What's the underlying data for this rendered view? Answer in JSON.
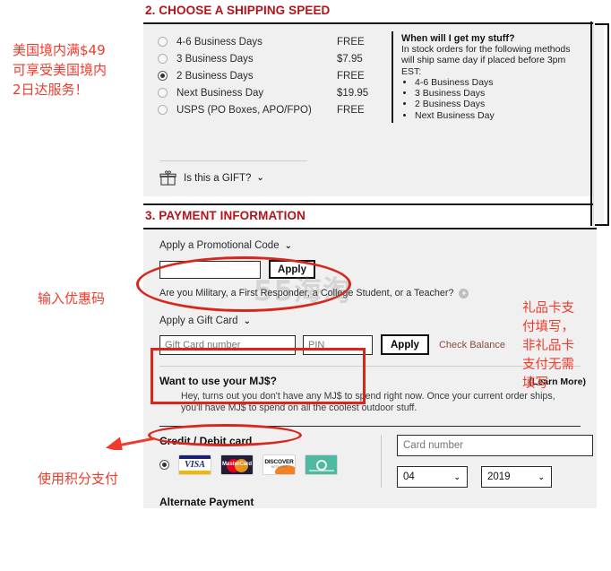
{
  "shipping": {
    "heading": "2. CHOOSE A SHIPPING SPEED",
    "options": [
      {
        "label": "4-6 Business Days",
        "price": "FREE",
        "selected": false
      },
      {
        "label": "3 Business Days",
        "price": "$7.95",
        "selected": false
      },
      {
        "label": "2 Business Days",
        "price": "FREE",
        "selected": true
      },
      {
        "label": "Next Business Day",
        "price": "$19.95",
        "selected": false
      },
      {
        "label": "USPS (PO Boxes, APO/FPO)",
        "price": "FREE",
        "selected": false
      }
    ],
    "info": {
      "title": "When will I get my stuff?",
      "line1": "In stock orders for the following methods",
      "line2": "will ship same day if placed before 3pm EST:",
      "bullets": [
        "4-6 Business Days",
        "3 Business Days",
        "2 Business Days",
        "Next Business Day"
      ]
    },
    "gift_label": "Is this a GIFT?"
  },
  "payment": {
    "heading": "3. PAYMENT INFORMATION",
    "promo": {
      "label": "Apply a Promotional Code",
      "input_value": "",
      "input_placeholder": "",
      "apply_label": "Apply"
    },
    "military_question": "Are you Military, a First Responder, a College Student, or a Teacher?",
    "giftcard": {
      "label": "Apply a Gift Card",
      "number_placeholder": "Gift Card number",
      "pin_placeholder": "PIN",
      "apply_label": "Apply",
      "check_balance_label": "Check Balance"
    },
    "mj": {
      "title": "Want to use your MJ$?",
      "learn_more": "(Learn More)",
      "body": "Hey, turns out you don't have any MJ$ to spend right now. Once your current order ships, you'll have MJ$ to spend on all the coolest outdoor stuff."
    },
    "credit_card": {
      "title": "Credit / Debit card",
      "brands": [
        "visa-card-icon",
        "mastercard-card-icon",
        "discover-card-icon",
        "amex-card-icon"
      ],
      "visa_text": "VISA",
      "mastercard_text": "MasterCard",
      "discover_text": "DISCOVER",
      "discover_sub": "NETWORK",
      "card_number_placeholder": "Card number",
      "exp_month": "04",
      "exp_year": "2019"
    },
    "alternate_payment_title": "Alternate Payment"
  },
  "annotations": {
    "shipping_note": "美国境内满$49\n可享受美国境内\n2日达服务！",
    "promo_note": "输入优惠码",
    "mj_note": "使用积分支付",
    "giftcard_note": "礼品卡支\n付填写，\n非礼品卡\n支付无需\n填写",
    "color": "#ef3b2c"
  },
  "watermark": {
    "text": "55海淘"
  },
  "chevron_glyph": "❯"
}
